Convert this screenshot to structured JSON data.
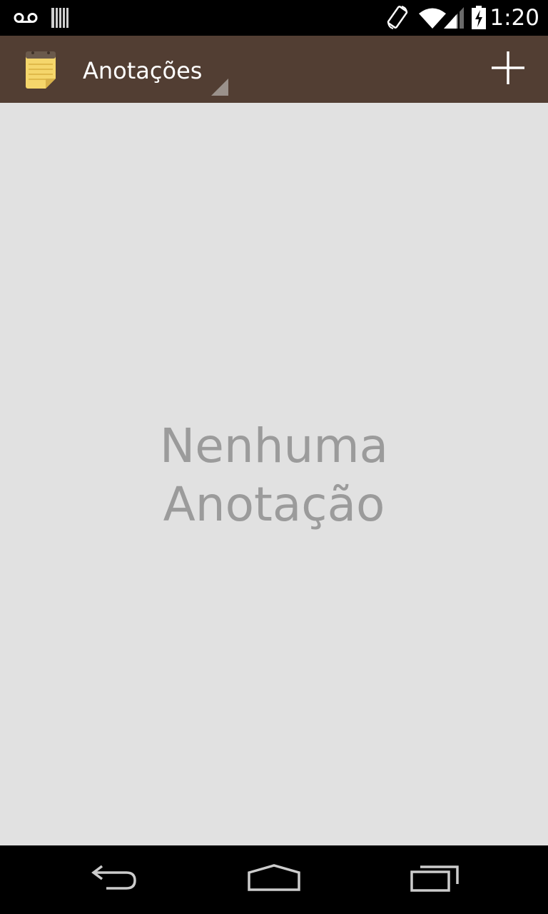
{
  "status_bar": {
    "time": "1:20",
    "icons": [
      "voicemail-icon",
      "sd-card-icon",
      "screen-rotation-icon",
      "wifi-icon",
      "signal-icon",
      "battery-charging-icon"
    ]
  },
  "action_bar": {
    "title": "Anotações",
    "app_icon": "notepad-icon",
    "action_icon": "add-icon",
    "color": "#523e33"
  },
  "main": {
    "empty_line1": "Nenhuma",
    "empty_line2": "Anotação",
    "background": "#e1e1e1"
  },
  "nav_bar": {
    "icons": [
      "back-icon",
      "home-icon",
      "recent-apps-icon"
    ]
  }
}
